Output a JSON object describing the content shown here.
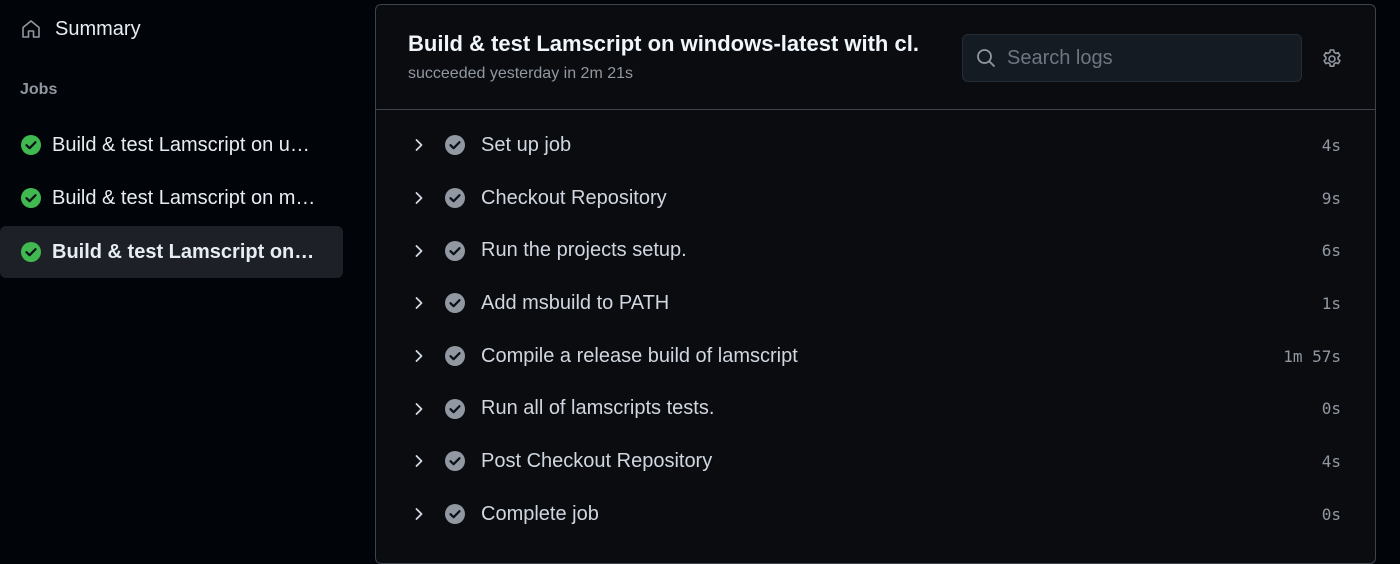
{
  "sidebar": {
    "summary_label": "Summary",
    "jobs_heading": "Jobs",
    "jobs": [
      {
        "label": "Build & test Lamscript on u…",
        "status": "success",
        "active": false
      },
      {
        "label": "Build & test Lamscript on m…",
        "status": "success",
        "active": false
      },
      {
        "label": "Build & test Lamscript on…",
        "status": "success",
        "active": true
      }
    ]
  },
  "job": {
    "title": "Build & test Lamscript on windows-latest with cl.",
    "status": "succeeded yesterday in 2m 21s"
  },
  "search": {
    "placeholder": "Search logs"
  },
  "steps": [
    {
      "name": "Set up job",
      "duration": "4s"
    },
    {
      "name": "Checkout Repository",
      "duration": "9s"
    },
    {
      "name": "Run the projects setup.",
      "duration": "6s"
    },
    {
      "name": "Add msbuild to PATH",
      "duration": "1s"
    },
    {
      "name": "Compile a release build of lamscript",
      "duration": "1m 57s"
    },
    {
      "name": "Run all of lamscripts tests.",
      "duration": "0s"
    },
    {
      "name": "Post Checkout Repository",
      "duration": "4s"
    },
    {
      "name": "Complete job",
      "duration": "0s"
    }
  ],
  "colors": {
    "success": "#3fb950",
    "step_check": "#9198a1",
    "background": "#010409",
    "active_item": "#1d2127"
  },
  "icons": {
    "summary": "home-icon",
    "job_status": "check-circle-fill-icon",
    "search": "search-icon",
    "settings": "gear-icon",
    "step_expand": "chevron-right-icon",
    "step_status": "check-circle-fill-icon"
  }
}
